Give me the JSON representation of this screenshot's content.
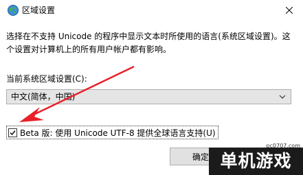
{
  "window": {
    "title": "区域设置",
    "icon": "globe-icon",
    "close_icon": "close-icon"
  },
  "description": {
    "line1": "选择在不支持 Unicode 的程序中显示文本时所使用的语言(系统区域设置)。这",
    "line2": "个设置对计算机上的所有用户帐户都有影响。"
  },
  "current_locale": {
    "label": "当前系统区域设置(C):",
    "value": "中文(简体，中国)"
  },
  "beta_option": {
    "label": "Beta 版: 使用 Unicode UTF-8 提供全球语言支持(U)",
    "checked": true
  },
  "buttons": {
    "ok": "确定"
  },
  "watermark": {
    "url": "pc0707.com",
    "logo_text": "单机游戏"
  },
  "colors": {
    "arrow": "#e8202a",
    "button_bg": "#e1e1e1",
    "select_bg": "#e5e5e5"
  }
}
